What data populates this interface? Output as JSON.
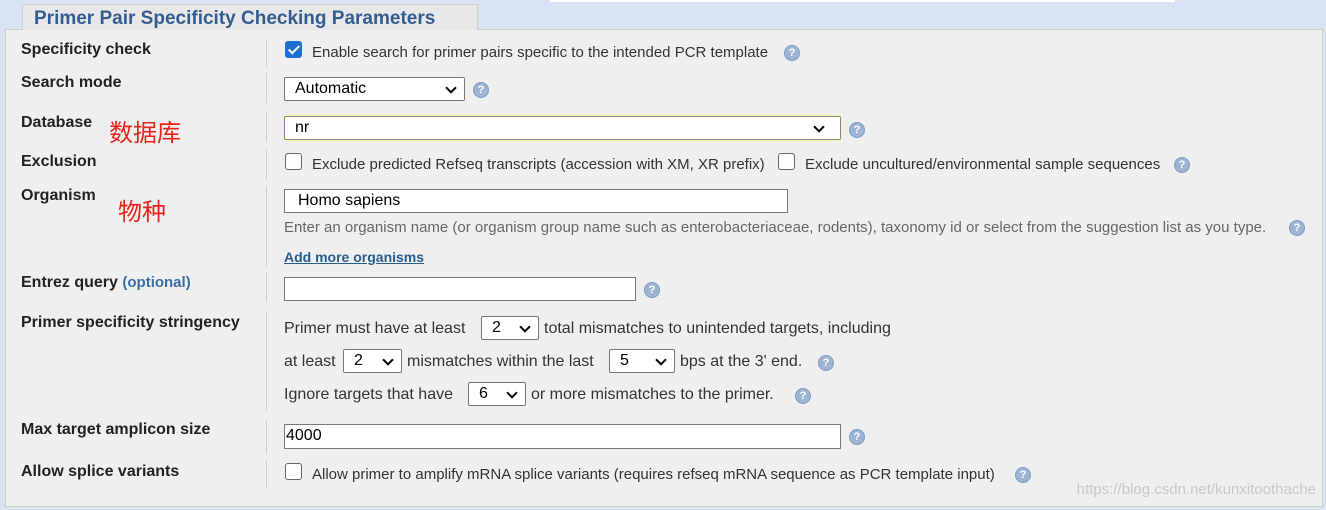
{
  "title": "Primer Pair Specificity Checking Parameters",
  "help_glyph": "?",
  "annotations": {
    "database": "数据库",
    "organism": "物种"
  },
  "specificity": {
    "label": "Specificity check",
    "checkbox_label": "Enable search for primer pairs specific to the intended PCR template",
    "checked": true
  },
  "search_mode": {
    "label": "Search mode",
    "value": "Automatic"
  },
  "database": {
    "label": "Database",
    "value": "nr"
  },
  "exclusion": {
    "label": "Exclusion",
    "refseq_label": "Exclude predicted Refseq transcripts (accession with XM, XR prefix)",
    "uncultured_label": "Exclude uncultured/environmental sample sequences"
  },
  "organism": {
    "label": "Organism",
    "value": "Homo sapiens",
    "hint": "Enter an organism name (or organism group name such as enterobacteriaceae, rodents), taxonomy id or select from the suggestion list as you type.",
    "add_more": "Add more organisms"
  },
  "entrez": {
    "label": "Entrez query",
    "optional": "(optional)",
    "value": ""
  },
  "stringency": {
    "label": "Primer specificity stringency",
    "line1_a": "Primer must have at least",
    "total_mismatches": "2",
    "line1_b": "total mismatches to unintended targets, including",
    "line2_a": "at least",
    "mismatches_within": "2",
    "line2_b": "mismatches within the last",
    "bps": "5",
    "line2_c": "bps at the 3' end.",
    "line3_a": "Ignore targets that have",
    "ignore_mismatches": "6",
    "line3_b": "or more mismatches to the primer."
  },
  "amplicon": {
    "label": "Max target amplicon size",
    "value": "4000"
  },
  "splice": {
    "label": "Allow splice variants",
    "checkbox_label": "Allow primer to amplify mRNA splice variants (requires refseq mRNA sequence as PCR template input)"
  },
  "watermark": "https://blog.csdn.net/kunxitoothache"
}
